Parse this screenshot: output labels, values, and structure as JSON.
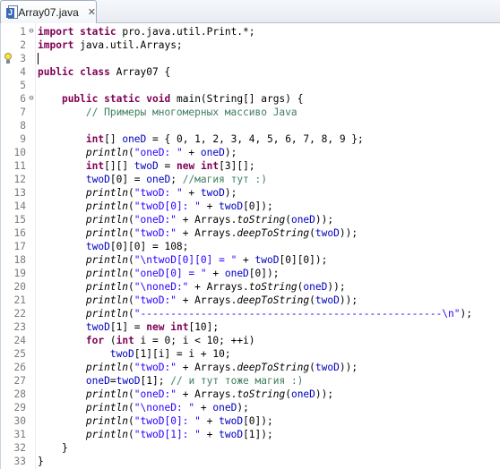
{
  "tab": {
    "icon": "java-file-icon",
    "title": "Array07.java",
    "close": "✕"
  },
  "lines": [
    {
      "n": "1",
      "marker": "⊖",
      "tokens": [
        [
          "kw",
          "import"
        ],
        [
          "t",
          " "
        ],
        [
          "kw",
          "static"
        ],
        [
          "t",
          " pro.java.util.Print.*;"
        ]
      ]
    },
    {
      "n": "2",
      "tokens": [
        [
          "kw",
          "import"
        ],
        [
          "t",
          " java.util.Arrays;"
        ]
      ]
    },
    {
      "n": "3",
      "tokens": []
    },
    {
      "n": "4",
      "tokens": [
        [
          "kw",
          "public"
        ],
        [
          "t",
          " "
        ],
        [
          "kw",
          "class"
        ],
        [
          "t",
          " Array07 {"
        ]
      ]
    },
    {
      "n": "5",
      "tokens": []
    },
    {
      "n": "6",
      "marker": "⊖",
      "tokens": [
        [
          "t",
          "    "
        ],
        [
          "kw",
          "public"
        ],
        [
          "t",
          " "
        ],
        [
          "kw",
          "static"
        ],
        [
          "t",
          " "
        ],
        [
          "kw",
          "void"
        ],
        [
          "t",
          " main(String[] args) {"
        ]
      ]
    },
    {
      "n": "7",
      "tokens": [
        [
          "t",
          "        "
        ],
        [
          "cmt",
          "// Примеры многомерных массиво Java"
        ]
      ]
    },
    {
      "n": "8",
      "tokens": []
    },
    {
      "n": "9",
      "tokens": [
        [
          "t",
          "        "
        ],
        [
          "kw",
          "int"
        ],
        [
          "t",
          "[] "
        ],
        [
          "fld",
          "oneD"
        ],
        [
          "t",
          " = { 0, 1, 2, 3, 4, 5, 6, 7, 8, 9 };"
        ]
      ]
    },
    {
      "n": "10",
      "tokens": [
        [
          "t",
          "        "
        ],
        [
          "mth",
          "println"
        ],
        [
          "t",
          "("
        ],
        [
          "str",
          "\"oneD: \""
        ],
        [
          "t",
          " + "
        ],
        [
          "fld",
          "oneD"
        ],
        [
          "t",
          ");"
        ]
      ]
    },
    {
      "n": "11",
      "tokens": [
        [
          "t",
          "        "
        ],
        [
          "kw",
          "int"
        ],
        [
          "t",
          "[][] "
        ],
        [
          "fld",
          "twoD"
        ],
        [
          "t",
          " = "
        ],
        [
          "kw",
          "new"
        ],
        [
          "t",
          " "
        ],
        [
          "kw",
          "int"
        ],
        [
          "t",
          "[3][];"
        ]
      ]
    },
    {
      "n": "12",
      "tokens": [
        [
          "t",
          "        "
        ],
        [
          "fld",
          "twoD"
        ],
        [
          "t",
          "[0] = "
        ],
        [
          "fld",
          "oneD"
        ],
        [
          "t",
          "; "
        ],
        [
          "cmt",
          "//магия тут :)"
        ]
      ]
    },
    {
      "n": "13",
      "tokens": [
        [
          "t",
          "        "
        ],
        [
          "mth",
          "println"
        ],
        [
          "t",
          "("
        ],
        [
          "str",
          "\"twoD: \""
        ],
        [
          "t",
          " + "
        ],
        [
          "fld",
          "twoD"
        ],
        [
          "t",
          ");"
        ]
      ]
    },
    {
      "n": "14",
      "tokens": [
        [
          "t",
          "        "
        ],
        [
          "mth",
          "println"
        ],
        [
          "t",
          "("
        ],
        [
          "str",
          "\"twoD[0]: \""
        ],
        [
          "t",
          " + "
        ],
        [
          "fld",
          "twoD"
        ],
        [
          "t",
          "[0]);"
        ]
      ]
    },
    {
      "n": "15",
      "tokens": [
        [
          "t",
          "        "
        ],
        [
          "mth",
          "println"
        ],
        [
          "t",
          "("
        ],
        [
          "str",
          "\"oneD:\""
        ],
        [
          "t",
          " + Arrays."
        ],
        [
          "mth",
          "toString"
        ],
        [
          "t",
          "("
        ],
        [
          "fld",
          "oneD"
        ],
        [
          "t",
          "));"
        ]
      ]
    },
    {
      "n": "16",
      "tokens": [
        [
          "t",
          "        "
        ],
        [
          "mth",
          "println"
        ],
        [
          "t",
          "("
        ],
        [
          "str",
          "\"twoD:\""
        ],
        [
          "t",
          " + Arrays."
        ],
        [
          "mth",
          "deepToString"
        ],
        [
          "t",
          "("
        ],
        [
          "fld",
          "twoD"
        ],
        [
          "t",
          "));"
        ]
      ]
    },
    {
      "n": "17",
      "tokens": [
        [
          "t",
          "        "
        ],
        [
          "fld",
          "twoD"
        ],
        [
          "t",
          "[0][0] = 108;"
        ]
      ]
    },
    {
      "n": "18",
      "tokens": [
        [
          "t",
          "        "
        ],
        [
          "mth",
          "println"
        ],
        [
          "t",
          "("
        ],
        [
          "str",
          "\"\\ntwoD[0][0] = \""
        ],
        [
          "t",
          " + "
        ],
        [
          "fld",
          "twoD"
        ],
        [
          "t",
          "[0][0]);"
        ]
      ]
    },
    {
      "n": "19",
      "tokens": [
        [
          "t",
          "        "
        ],
        [
          "mth",
          "println"
        ],
        [
          "t",
          "("
        ],
        [
          "str",
          "\"oneD[0] = \""
        ],
        [
          "t",
          " + "
        ],
        [
          "fld",
          "oneD"
        ],
        [
          "t",
          "[0]);"
        ]
      ]
    },
    {
      "n": "20",
      "tokens": [
        [
          "t",
          "        "
        ],
        [
          "mth",
          "println"
        ],
        [
          "t",
          "("
        ],
        [
          "str",
          "\"\\noneD:\""
        ],
        [
          "t",
          " + Arrays."
        ],
        [
          "mth",
          "toString"
        ],
        [
          "t",
          "("
        ],
        [
          "fld",
          "oneD"
        ],
        [
          "t",
          "));"
        ]
      ]
    },
    {
      "n": "21",
      "tokens": [
        [
          "t",
          "        "
        ],
        [
          "mth",
          "println"
        ],
        [
          "t",
          "("
        ],
        [
          "str",
          "\"twoD:\""
        ],
        [
          "t",
          " + Arrays."
        ],
        [
          "mth",
          "deepToString"
        ],
        [
          "t",
          "("
        ],
        [
          "fld",
          "twoD"
        ],
        [
          "t",
          "));"
        ]
      ]
    },
    {
      "n": "22",
      "tokens": [
        [
          "t",
          "        "
        ],
        [
          "mth",
          "println"
        ],
        [
          "t",
          "("
        ],
        [
          "str",
          "\"--------------------------------------------------\\n\""
        ],
        [
          "t",
          ");"
        ]
      ]
    },
    {
      "n": "23",
      "tokens": [
        [
          "t",
          "        "
        ],
        [
          "fld",
          "twoD"
        ],
        [
          "t",
          "[1] = "
        ],
        [
          "kw",
          "new"
        ],
        [
          "t",
          " "
        ],
        [
          "kw",
          "int"
        ],
        [
          "t",
          "[10];"
        ]
      ]
    },
    {
      "n": "24",
      "tokens": [
        [
          "t",
          "        "
        ],
        [
          "kw",
          "for"
        ],
        [
          "t",
          " ("
        ],
        [
          "kw",
          "int"
        ],
        [
          "t",
          " i = 0; i < 10; ++i)"
        ]
      ]
    },
    {
      "n": "25",
      "tokens": [
        [
          "t",
          "            "
        ],
        [
          "fld",
          "twoD"
        ],
        [
          "t",
          "[1][i] = i + 10;"
        ]
      ]
    },
    {
      "n": "26",
      "tokens": [
        [
          "t",
          "        "
        ],
        [
          "mth",
          "println"
        ],
        [
          "t",
          "("
        ],
        [
          "str",
          "\"twoD:\""
        ],
        [
          "t",
          " + Arrays."
        ],
        [
          "mth",
          "deepToString"
        ],
        [
          "t",
          "("
        ],
        [
          "fld",
          "twoD"
        ],
        [
          "t",
          "));"
        ]
      ]
    },
    {
      "n": "27",
      "tokens": [
        [
          "t",
          "        "
        ],
        [
          "fld",
          "oneD"
        ],
        [
          "t",
          "="
        ],
        [
          "fld",
          "twoD"
        ],
        [
          "t",
          "[1]; "
        ],
        [
          "cmt",
          "// и тут тоже магия :)"
        ]
      ]
    },
    {
      "n": "28",
      "tokens": [
        [
          "t",
          "        "
        ],
        [
          "mth",
          "println"
        ],
        [
          "t",
          "("
        ],
        [
          "str",
          "\"oneD:\""
        ],
        [
          "t",
          " + Arrays."
        ],
        [
          "mth",
          "toString"
        ],
        [
          "t",
          "("
        ],
        [
          "fld",
          "oneD"
        ],
        [
          "t",
          "));"
        ]
      ]
    },
    {
      "n": "29",
      "tokens": [
        [
          "t",
          "        "
        ],
        [
          "mth",
          "println"
        ],
        [
          "t",
          "("
        ],
        [
          "str",
          "\"\\noneD: \""
        ],
        [
          "t",
          " + "
        ],
        [
          "fld",
          "oneD"
        ],
        [
          "t",
          ");"
        ]
      ]
    },
    {
      "n": "30",
      "tokens": [
        [
          "t",
          "        "
        ],
        [
          "mth",
          "println"
        ],
        [
          "t",
          "("
        ],
        [
          "str",
          "\"twoD[0]: \""
        ],
        [
          "t",
          " + "
        ],
        [
          "fld",
          "twoD"
        ],
        [
          "t",
          "[0]);"
        ]
      ]
    },
    {
      "n": "31",
      "tokens": [
        [
          "t",
          "        "
        ],
        [
          "mth",
          "println"
        ],
        [
          "t",
          "("
        ],
        [
          "str",
          "\"twoD[1]: \""
        ],
        [
          "t",
          " + "
        ],
        [
          "fld",
          "twoD"
        ],
        [
          "t",
          "[1]);"
        ]
      ]
    },
    {
      "n": "32",
      "tokens": [
        [
          "t",
          "    }"
        ]
      ]
    },
    {
      "n": "33",
      "tokens": [
        [
          "t",
          "}"
        ]
      ]
    }
  ],
  "quick_assist_line": "3",
  "cursor_line": "3"
}
